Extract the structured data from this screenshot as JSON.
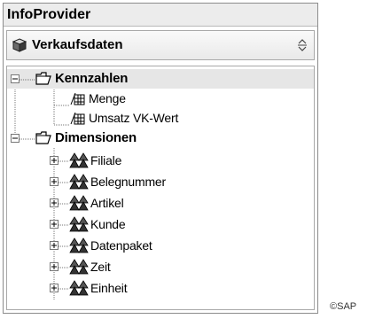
{
  "panel": {
    "title": "InfoProvider",
    "selector": {
      "value": "Verkaufsdaten",
      "icon": "cube-icon"
    }
  },
  "tree": {
    "keyfigures": {
      "label": "Kennzahlen",
      "items": [
        {
          "label": "Menge"
        },
        {
          "label": "Umsatz VK-Wert"
        }
      ]
    },
    "dimensions": {
      "label": "Dimensionen",
      "items": [
        {
          "label": "Filiale"
        },
        {
          "label": "Belegnummer"
        },
        {
          "label": "Artikel"
        },
        {
          "label": "Kunde"
        },
        {
          "label": "Datenpaket"
        },
        {
          "label": "Zeit"
        },
        {
          "label": "Einheit"
        }
      ]
    }
  },
  "copyright": "©SAP"
}
